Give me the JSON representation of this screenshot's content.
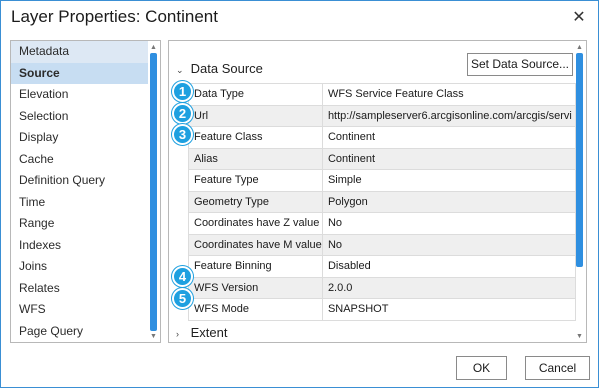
{
  "window": {
    "title": "Layer Properties: Continent",
    "close_glyph": "✕"
  },
  "nav": {
    "items": [
      {
        "label": "Metadata",
        "state": "hover"
      },
      {
        "label": "Source",
        "state": "selected"
      },
      {
        "label": "Elevation"
      },
      {
        "label": "Selection"
      },
      {
        "label": "Display"
      },
      {
        "label": "Cache"
      },
      {
        "label": "Definition Query"
      },
      {
        "label": "Time"
      },
      {
        "label": "Range"
      },
      {
        "label": "Indexes"
      },
      {
        "label": "Joins"
      },
      {
        "label": "Relates"
      },
      {
        "label": "WFS"
      },
      {
        "label": "Page Query"
      }
    ]
  },
  "panel": {
    "section_title": "Data Source",
    "section_chevron": "⌄",
    "set_source_label": "Set Data Source...",
    "rows": [
      {
        "key": "Data Type",
        "value": "WFS Service Feature Class"
      },
      {
        "key": "Url",
        "value": "http://sampleserver6.arcgisonline.com/arcgis/servi"
      },
      {
        "key": "Feature Class",
        "value": "Continent"
      },
      {
        "key": "Alias",
        "value": "Continent"
      },
      {
        "key": "Feature Type",
        "value": "Simple"
      },
      {
        "key": "Geometry Type",
        "value": "Polygon"
      },
      {
        "key": "Coordinates have Z value",
        "value": "No"
      },
      {
        "key": "Coordinates have M value",
        "value": "No"
      },
      {
        "key": "Feature Binning",
        "value": "Disabled"
      },
      {
        "key": "WFS Version",
        "value": "2.0.0"
      },
      {
        "key": "WFS Mode",
        "value": "SNAPSHOT"
      }
    ],
    "badges": [
      "1",
      "2",
      "3",
      "4",
      "5"
    ],
    "extent_label": "Extent",
    "extent_chevron": "›"
  },
  "footer": {
    "ok_label": "OK",
    "cancel_label": "Cancel"
  },
  "colors": {
    "accent": "#2f8fe0",
    "badge": "#1ea0e0",
    "selected": "#c7ddf2"
  }
}
